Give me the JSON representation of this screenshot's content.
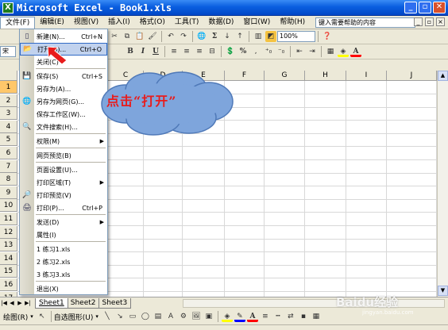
{
  "window": {
    "title": "Microsoft Excel - Book1.xls",
    "icon": "excel-icon"
  },
  "menubar": {
    "items": [
      "文件(F)",
      "编辑(E)",
      "视图(V)",
      "插入(I)",
      "格式(O)",
      "工具(T)",
      "数据(D)",
      "窗口(W)",
      "帮助(H)"
    ],
    "help_placeholder": "键入需要帮助的内容"
  },
  "toolbar": {
    "zoom": "100%",
    "font_name": "宋"
  },
  "grid": {
    "columns": [
      "C",
      "D",
      "E",
      "F",
      "G",
      "H",
      "I",
      "J"
    ],
    "rows": [
      "1",
      "2",
      "3",
      "4",
      "5",
      "6",
      "7",
      "8",
      "9",
      "10",
      "11",
      "12",
      "13",
      "14",
      "15",
      "16",
      "17",
      "18",
      "19"
    ]
  },
  "file_menu": {
    "items": [
      {
        "label": "新建(N)...",
        "shortcut": "Ctrl+N",
        "icon": "new-doc-icon"
      },
      {
        "label": "打开(O)...",
        "shortcut": "Ctrl+O",
        "icon": "open-folder-icon",
        "highlight": true
      },
      {
        "label": "关闭(C)",
        "shortcut": "",
        "icon": ""
      },
      {
        "label": "保存(S)",
        "shortcut": "Ctrl+S",
        "icon": "save-icon"
      },
      {
        "label": "另存为(A)...",
        "shortcut": "",
        "icon": ""
      },
      {
        "label": "另存为网页(G)...",
        "shortcut": "",
        "icon": "web-page-icon"
      },
      {
        "label": "保存工作区(W)...",
        "shortcut": "",
        "icon": ""
      },
      {
        "label": "文件搜索(H)...",
        "shortcut": "",
        "icon": "search-icon"
      },
      {
        "label": "权限(M)",
        "shortcut": "",
        "icon": "",
        "submenu": true
      },
      {
        "label": "网页预览(B)",
        "shortcut": "",
        "icon": ""
      },
      {
        "label": "页面设置(U)...",
        "shortcut": "",
        "icon": ""
      },
      {
        "label": "打印区域(T)",
        "shortcut": "",
        "icon": "",
        "submenu": true
      },
      {
        "label": "打印预览(V)",
        "shortcut": "",
        "icon": "print-preview-icon"
      },
      {
        "label": "打印(P)...",
        "shortcut": "Ctrl+P",
        "icon": "print-icon"
      },
      {
        "label": "发送(D)",
        "shortcut": "",
        "icon": "",
        "submenu": true
      },
      {
        "label": "属性(I)",
        "shortcut": "",
        "icon": ""
      },
      {
        "label": "1 练习1.xls",
        "shortcut": "",
        "icon": ""
      },
      {
        "label": "2 练习2.xls",
        "shortcut": "",
        "icon": ""
      },
      {
        "label": "3 练习3.xls",
        "shortcut": "",
        "icon": ""
      },
      {
        "label": "退出(X)",
        "shortcut": "",
        "icon": ""
      }
    ]
  },
  "sheets": [
    "Sheet1",
    "Sheet2",
    "Sheet3"
  ],
  "drawbar": {
    "draw_label": "绘图(R)",
    "autoshape_label": "自选图形(U)"
  },
  "callout": {
    "text": "点击“打开”"
  },
  "watermark": {
    "text": "Baidu经验",
    "sub": "jingyan.baidu.com"
  },
  "colors": {
    "titlebar": "#0a5ee0",
    "callout_cloud": "#7ea5dc",
    "callout_text": "#e81c1c",
    "arrow": "#e81c1c"
  }
}
